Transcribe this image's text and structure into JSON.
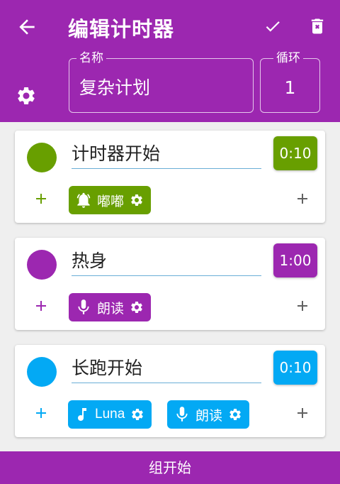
{
  "header": {
    "title": "编辑计时器",
    "name_label": "名称",
    "name_value": "复杂计划",
    "loop_label": "循环",
    "loop_value": "1"
  },
  "steps": [
    {
      "name": "计时器开始",
      "time": "0:10",
      "color": "#689f00",
      "chips": [
        {
          "icon": "bell-ring-icon",
          "label": "嘟嘟"
        }
      ]
    },
    {
      "name": "热身",
      "time": "1:00",
      "color": "#9c27b0",
      "chips": [
        {
          "icon": "microphone-icon",
          "label": "朗读"
        }
      ]
    },
    {
      "name": "长跑开始",
      "time": "0:10",
      "color": "#03a9f4",
      "chips": [
        {
          "icon": "music-note-icon",
          "label": "Luna"
        },
        {
          "icon": "microphone-icon",
          "label": "朗读"
        }
      ]
    }
  ],
  "footer": {
    "start_group_label": "组开始"
  },
  "colors": {
    "accent": "#9c27b0"
  }
}
